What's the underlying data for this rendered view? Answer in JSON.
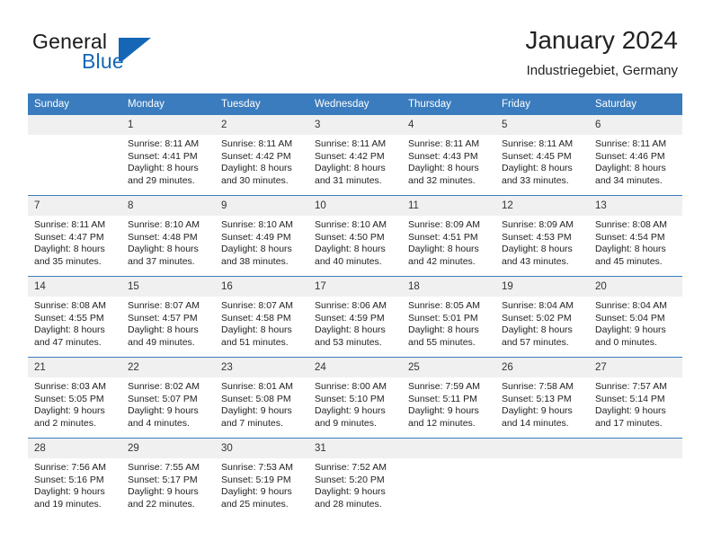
{
  "brand": {
    "name_part1": "General",
    "name_part2": "Blue",
    "mark": "triangle-flag-logo"
  },
  "header": {
    "title": "January 2024",
    "subtitle": "Industriegebiet, Germany"
  },
  "calendar": {
    "weekday_headers": [
      "Sunday",
      "Monday",
      "Tuesday",
      "Wednesday",
      "Thursday",
      "Friday",
      "Saturday"
    ],
    "accent_color": "#3a7cbe",
    "daynum_band_color": "#f0f0f0",
    "weeks": [
      [
        {
          "day": "",
          "empty": true,
          "sunrise": "",
          "sunset": "",
          "daylight_line1": "",
          "daylight_line2": ""
        },
        {
          "day": "1",
          "sunrise": "Sunrise: 8:11 AM",
          "sunset": "Sunset: 4:41 PM",
          "daylight_line1": "Daylight: 8 hours",
          "daylight_line2": "and 29 minutes."
        },
        {
          "day": "2",
          "sunrise": "Sunrise: 8:11 AM",
          "sunset": "Sunset: 4:42 PM",
          "daylight_line1": "Daylight: 8 hours",
          "daylight_line2": "and 30 minutes."
        },
        {
          "day": "3",
          "sunrise": "Sunrise: 8:11 AM",
          "sunset": "Sunset: 4:42 PM",
          "daylight_line1": "Daylight: 8 hours",
          "daylight_line2": "and 31 minutes."
        },
        {
          "day": "4",
          "sunrise": "Sunrise: 8:11 AM",
          "sunset": "Sunset: 4:43 PM",
          "daylight_line1": "Daylight: 8 hours",
          "daylight_line2": "and 32 minutes."
        },
        {
          "day": "5",
          "sunrise": "Sunrise: 8:11 AM",
          "sunset": "Sunset: 4:45 PM",
          "daylight_line1": "Daylight: 8 hours",
          "daylight_line2": "and 33 minutes."
        },
        {
          "day": "6",
          "sunrise": "Sunrise: 8:11 AM",
          "sunset": "Sunset: 4:46 PM",
          "daylight_line1": "Daylight: 8 hours",
          "daylight_line2": "and 34 minutes."
        }
      ],
      [
        {
          "day": "7",
          "sunrise": "Sunrise: 8:11 AM",
          "sunset": "Sunset: 4:47 PM",
          "daylight_line1": "Daylight: 8 hours",
          "daylight_line2": "and 35 minutes."
        },
        {
          "day": "8",
          "sunrise": "Sunrise: 8:10 AM",
          "sunset": "Sunset: 4:48 PM",
          "daylight_line1": "Daylight: 8 hours",
          "daylight_line2": "and 37 minutes."
        },
        {
          "day": "9",
          "sunrise": "Sunrise: 8:10 AM",
          "sunset": "Sunset: 4:49 PM",
          "daylight_line1": "Daylight: 8 hours",
          "daylight_line2": "and 38 minutes."
        },
        {
          "day": "10",
          "sunrise": "Sunrise: 8:10 AM",
          "sunset": "Sunset: 4:50 PM",
          "daylight_line1": "Daylight: 8 hours",
          "daylight_line2": "and 40 minutes."
        },
        {
          "day": "11",
          "sunrise": "Sunrise: 8:09 AM",
          "sunset": "Sunset: 4:51 PM",
          "daylight_line1": "Daylight: 8 hours",
          "daylight_line2": "and 42 minutes."
        },
        {
          "day": "12",
          "sunrise": "Sunrise: 8:09 AM",
          "sunset": "Sunset: 4:53 PM",
          "daylight_line1": "Daylight: 8 hours",
          "daylight_line2": "and 43 minutes."
        },
        {
          "day": "13",
          "sunrise": "Sunrise: 8:08 AM",
          "sunset": "Sunset: 4:54 PM",
          "daylight_line1": "Daylight: 8 hours",
          "daylight_line2": "and 45 minutes."
        }
      ],
      [
        {
          "day": "14",
          "sunrise": "Sunrise: 8:08 AM",
          "sunset": "Sunset: 4:55 PM",
          "daylight_line1": "Daylight: 8 hours",
          "daylight_line2": "and 47 minutes."
        },
        {
          "day": "15",
          "sunrise": "Sunrise: 8:07 AM",
          "sunset": "Sunset: 4:57 PM",
          "daylight_line1": "Daylight: 8 hours",
          "daylight_line2": "and 49 minutes."
        },
        {
          "day": "16",
          "sunrise": "Sunrise: 8:07 AM",
          "sunset": "Sunset: 4:58 PM",
          "daylight_line1": "Daylight: 8 hours",
          "daylight_line2": "and 51 minutes."
        },
        {
          "day": "17",
          "sunrise": "Sunrise: 8:06 AM",
          "sunset": "Sunset: 4:59 PM",
          "daylight_line1": "Daylight: 8 hours",
          "daylight_line2": "and 53 minutes."
        },
        {
          "day": "18",
          "sunrise": "Sunrise: 8:05 AM",
          "sunset": "Sunset: 5:01 PM",
          "daylight_line1": "Daylight: 8 hours",
          "daylight_line2": "and 55 minutes."
        },
        {
          "day": "19",
          "sunrise": "Sunrise: 8:04 AM",
          "sunset": "Sunset: 5:02 PM",
          "daylight_line1": "Daylight: 8 hours",
          "daylight_line2": "and 57 minutes."
        },
        {
          "day": "20",
          "sunrise": "Sunrise: 8:04 AM",
          "sunset": "Sunset: 5:04 PM",
          "daylight_line1": "Daylight: 9 hours",
          "daylight_line2": "and 0 minutes."
        }
      ],
      [
        {
          "day": "21",
          "sunrise": "Sunrise: 8:03 AM",
          "sunset": "Sunset: 5:05 PM",
          "daylight_line1": "Daylight: 9 hours",
          "daylight_line2": "and 2 minutes."
        },
        {
          "day": "22",
          "sunrise": "Sunrise: 8:02 AM",
          "sunset": "Sunset: 5:07 PM",
          "daylight_line1": "Daylight: 9 hours",
          "daylight_line2": "and 4 minutes."
        },
        {
          "day": "23",
          "sunrise": "Sunrise: 8:01 AM",
          "sunset": "Sunset: 5:08 PM",
          "daylight_line1": "Daylight: 9 hours",
          "daylight_line2": "and 7 minutes."
        },
        {
          "day": "24",
          "sunrise": "Sunrise: 8:00 AM",
          "sunset": "Sunset: 5:10 PM",
          "daylight_line1": "Daylight: 9 hours",
          "daylight_line2": "and 9 minutes."
        },
        {
          "day": "25",
          "sunrise": "Sunrise: 7:59 AM",
          "sunset": "Sunset: 5:11 PM",
          "daylight_line1": "Daylight: 9 hours",
          "daylight_line2": "and 12 minutes."
        },
        {
          "day": "26",
          "sunrise": "Sunrise: 7:58 AM",
          "sunset": "Sunset: 5:13 PM",
          "daylight_line1": "Daylight: 9 hours",
          "daylight_line2": "and 14 minutes."
        },
        {
          "day": "27",
          "sunrise": "Sunrise: 7:57 AM",
          "sunset": "Sunset: 5:14 PM",
          "daylight_line1": "Daylight: 9 hours",
          "daylight_line2": "and 17 minutes."
        }
      ],
      [
        {
          "day": "28",
          "sunrise": "Sunrise: 7:56 AM",
          "sunset": "Sunset: 5:16 PM",
          "daylight_line1": "Daylight: 9 hours",
          "daylight_line2": "and 19 minutes."
        },
        {
          "day": "29",
          "sunrise": "Sunrise: 7:55 AM",
          "sunset": "Sunset: 5:17 PM",
          "daylight_line1": "Daylight: 9 hours",
          "daylight_line2": "and 22 minutes."
        },
        {
          "day": "30",
          "sunrise": "Sunrise: 7:53 AM",
          "sunset": "Sunset: 5:19 PM",
          "daylight_line1": "Daylight: 9 hours",
          "daylight_line2": "and 25 minutes."
        },
        {
          "day": "31",
          "sunrise": "Sunrise: 7:52 AM",
          "sunset": "Sunset: 5:20 PM",
          "daylight_line1": "Daylight: 9 hours",
          "daylight_line2": "and 28 minutes."
        },
        {
          "day": "",
          "empty": true,
          "sunrise": "",
          "sunset": "",
          "daylight_line1": "",
          "daylight_line2": ""
        },
        {
          "day": "",
          "empty": true,
          "sunrise": "",
          "sunset": "",
          "daylight_line1": "",
          "daylight_line2": ""
        },
        {
          "day": "",
          "empty": true,
          "sunrise": "",
          "sunset": "",
          "daylight_line1": "",
          "daylight_line2": ""
        }
      ]
    ]
  }
}
